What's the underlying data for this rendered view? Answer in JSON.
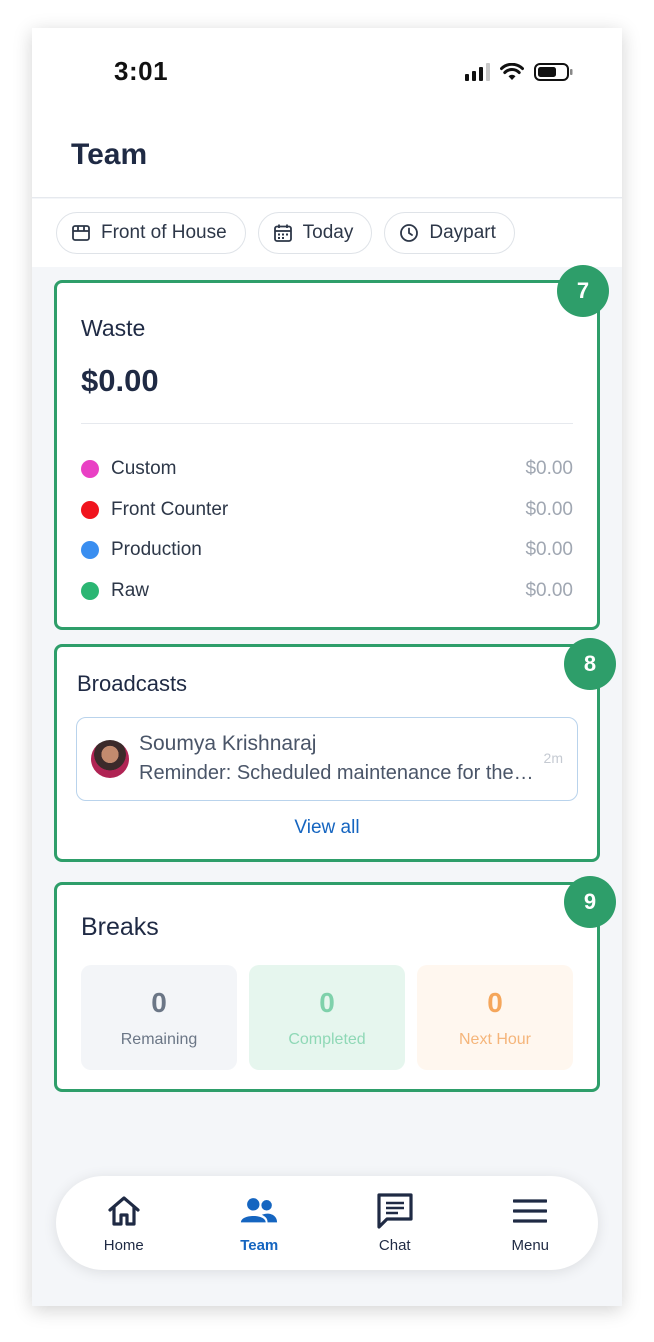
{
  "status_bar": {
    "time": "3:01"
  },
  "header": {
    "title": "Team"
  },
  "filters": [
    {
      "label": "Front of House",
      "icon": "store-icon"
    },
    {
      "label": "Today",
      "icon": "calendar-icon"
    },
    {
      "label": "Daypart",
      "icon": "clock-icon"
    }
  ],
  "waste": {
    "badge": "7",
    "title": "Waste",
    "total": "$0.00",
    "items": [
      {
        "label": "Custom",
        "amount": "$0.00",
        "color": "#e940c4"
      },
      {
        "label": "Front Counter",
        "amount": "$0.00",
        "color": "#f0141e"
      },
      {
        "label": "Production",
        "amount": "$0.00",
        "color": "#3a8ef0"
      },
      {
        "label": "Raw",
        "amount": "$0.00",
        "color": "#2bb673"
      }
    ]
  },
  "broadcasts": {
    "badge": "8",
    "title": "Broadcasts",
    "item": {
      "name": "Soumya Krishnaraj",
      "message": "Reminder: Scheduled maintenance for the POS system tonight",
      "time": "2m"
    },
    "view_all": "View all"
  },
  "breaks": {
    "badge": "9",
    "title": "Breaks",
    "stats": [
      {
        "value": "0",
        "label": "Remaining"
      },
      {
        "value": "0",
        "label": "Completed"
      },
      {
        "value": "0",
        "label": "Next Hour"
      }
    ]
  },
  "nav": {
    "items": [
      {
        "label": "Home",
        "icon": "home-icon"
      },
      {
        "label": "Team",
        "icon": "team-icon"
      },
      {
        "label": "Chat",
        "icon": "chat-icon"
      },
      {
        "label": "Menu",
        "icon": "menu-icon"
      }
    ],
    "active": "Team"
  },
  "colors": {
    "accent": "#2e9e6a",
    "link": "#1565c0",
    "text": "#1f2a44"
  }
}
